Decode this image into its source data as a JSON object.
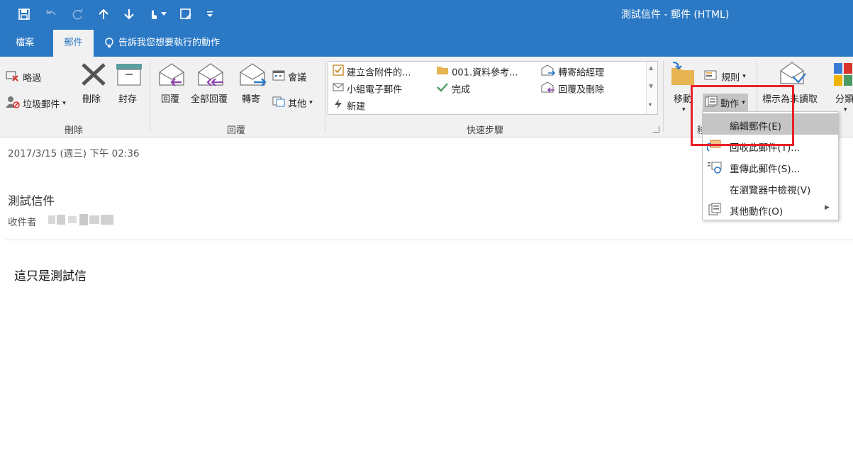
{
  "window": {
    "title": "測試信件 - 郵件 (HTML)"
  },
  "qat": {
    "icons": [
      "save-icon",
      "undo-icon",
      "redo-icon",
      "up-arrow-icon",
      "down-arrow-icon",
      "touch-mode-icon",
      "dropdown-arrow-icon",
      "edit-doc-icon",
      "customize-icon"
    ]
  },
  "tabs": {
    "file": "檔案",
    "message": "郵件",
    "tell_me": "告訴我您想要執行的動作"
  },
  "ribbon": {
    "delete_group": {
      "ignore": "略過",
      "junk": "垃圾郵件",
      "delete": "刪除",
      "archive": "封存",
      "label": "刪除"
    },
    "respond_group": {
      "reply": "回覆",
      "reply_all": "全部回覆",
      "forward": "轉寄",
      "meeting": "會議",
      "more": "其他",
      "label": "回覆"
    },
    "quick_steps": {
      "items": [
        "建立含附件的...",
        "小組電子郵件",
        "新建",
        "001.資料參考...",
        "完成",
        "轉寄給經理",
        "回覆及刪除"
      ],
      "label": "快速步驟"
    },
    "move_group": {
      "move": "移動",
      "rules": "規則",
      "actions": "動作",
      "label_partial": "移"
    },
    "tags_group": {
      "mark_unread": "標示為未讀取",
      "categorize": "分類"
    }
  },
  "message": {
    "date": "2017/3/15 (週三) 下午 02:36",
    "subject": "測試信件",
    "to_label": "收件者",
    "body": "這只是測試信"
  },
  "actions_menu": {
    "items": [
      {
        "label": "編輯郵件(E)",
        "icon": "edit-icon"
      },
      {
        "label": "回收此郵件(T)...",
        "icon": "recall-icon"
      },
      {
        "label": "重傳此郵件(S)...",
        "icon": "resend-icon"
      },
      {
        "label": "在瀏覽器中檢視(V)",
        "icon": ""
      },
      {
        "label": "其他動作(O)",
        "icon": "other-actions-icon"
      }
    ]
  },
  "colors": {
    "brand": "#2b79c5",
    "highlight_box": "#e8202a",
    "menu_hover": "#c5c5c5"
  }
}
